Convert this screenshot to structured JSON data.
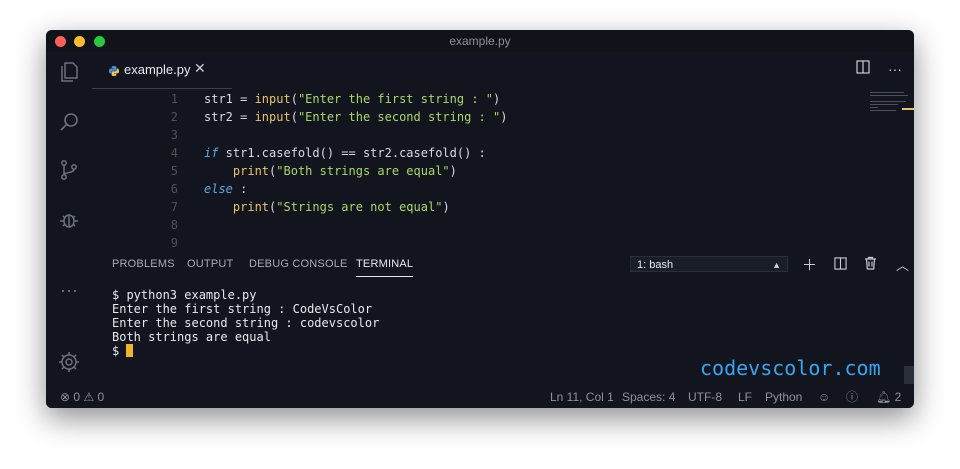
{
  "window": {
    "title": "example.py"
  },
  "tab": {
    "filename": "example.py"
  },
  "editor": {
    "lines": [
      {
        "n": "1",
        "tokens": [
          [
            "op",
            "str1 = "
          ],
          [
            "fn",
            "input"
          ],
          [
            "op",
            "("
          ],
          [
            "str",
            "\"Enter the first string : \""
          ],
          [
            "op",
            ")"
          ]
        ]
      },
      {
        "n": "2",
        "tokens": [
          [
            "op",
            "str2 = "
          ],
          [
            "fn",
            "input"
          ],
          [
            "op",
            "("
          ],
          [
            "str",
            "\"Enter the second string : \""
          ],
          [
            "op",
            ")"
          ]
        ]
      },
      {
        "n": "3",
        "tokens": []
      },
      {
        "n": "4",
        "tokens": [
          [
            "kw",
            "if"
          ],
          [
            "op",
            " str1.casefold() == str2.casefold() :"
          ]
        ]
      },
      {
        "n": "5",
        "tokens": [
          [
            "op",
            "    "
          ],
          [
            "fn",
            "print"
          ],
          [
            "op",
            "("
          ],
          [
            "str",
            "\"Both strings are equal\""
          ],
          [
            "op",
            ")"
          ]
        ]
      },
      {
        "n": "6",
        "tokens": [
          [
            "kw",
            "else"
          ],
          [
            "op",
            " :"
          ]
        ]
      },
      {
        "n": "7",
        "tokens": [
          [
            "op",
            "    "
          ],
          [
            "fn",
            "print"
          ],
          [
            "op",
            "("
          ],
          [
            "str",
            "\"Strings are not equal\""
          ],
          [
            "op",
            ")"
          ]
        ]
      },
      {
        "n": "8",
        "tokens": []
      },
      {
        "n": "9",
        "tokens": []
      }
    ]
  },
  "panel": {
    "tabs": [
      "PROBLEMS",
      "OUTPUT",
      "DEBUG CONSOLE",
      "TERMINAL"
    ],
    "active_tab": "TERMINAL",
    "shell_select": "1: bash"
  },
  "terminal": {
    "lines": [
      "$ python3 example.py",
      "Enter the first string : CodeVsColor",
      "Enter the second string : codevscolor",
      "Both strings are equal"
    ],
    "prompt": "$ "
  },
  "watermark": "codevscolor.com",
  "status": {
    "errors": "0",
    "warnings": "0",
    "position": "Ln 11, Col 1",
    "spaces": "Spaces: 4",
    "encoding": "UTF-8",
    "eol": "LF",
    "language": "Python",
    "notifications": "2"
  },
  "colors": {
    "keyword": "#5aa8e8",
    "function": "#e8c36a",
    "string": "#a8d86a",
    "cursor": "#f0b429",
    "watermark": "#36a5f2"
  }
}
